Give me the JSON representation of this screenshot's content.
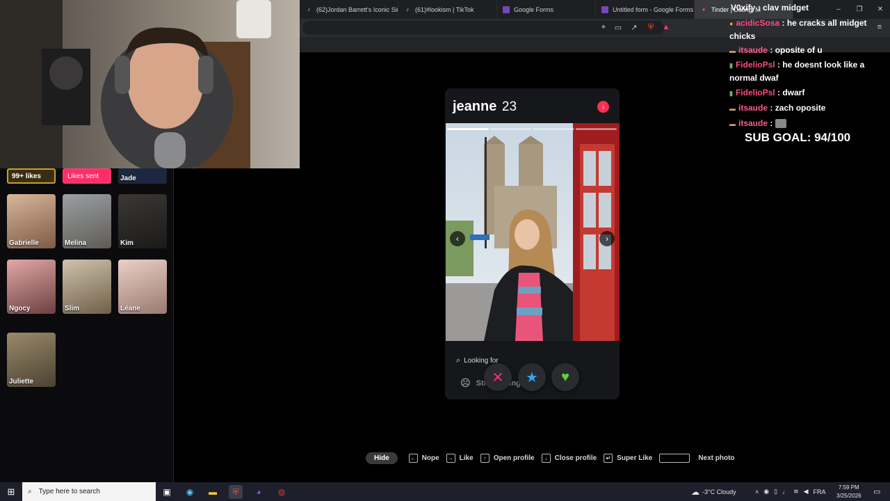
{
  "browser": {
    "tabs": [
      {
        "label": "(62)Jordan Barrett's Iconic Sina",
        "icon": "tiktok-icon"
      },
      {
        "label": "(61)#lookism | TikTok",
        "icon": "tiktok-icon"
      },
      {
        "label": "Google Forms",
        "icon": "forms-icon"
      },
      {
        "label": "Untitled form - Google Forms",
        "icon": "forms-icon"
      },
      {
        "label": "Tinder | Dating, M",
        "icon": "tinder-icon"
      }
    ]
  },
  "left_panel": {
    "likes_label": "99+ likes",
    "sent_label": "Likes sent",
    "profiles": [
      {
        "name": "Jade"
      },
      {
        "name": "Gabrielle"
      },
      {
        "name": "Melina"
      },
      {
        "name": "Kim"
      },
      {
        "name": "Ngocy"
      },
      {
        "name": "Slim"
      },
      {
        "name": "Léane"
      },
      {
        "name": "Juliette"
      }
    ]
  },
  "card": {
    "name": "jeanne",
    "age": "23",
    "looking_for_label": "Looking for",
    "looking_for_value": "Still figuring it out",
    "photo_count": 4,
    "active_photo": 1
  },
  "hints": {
    "hide": "Hide",
    "items": [
      {
        "key": "←",
        "label": "Nope"
      },
      {
        "key": "→",
        "label": "Like"
      },
      {
        "key": "↑",
        "label": "Open profile"
      },
      {
        "key": "↓",
        "label": "Close profile"
      },
      {
        "key": "↵",
        "label": "Super Like"
      },
      {
        "key": "",
        "label": "Next photo"
      }
    ]
  },
  "chat": {
    "messages": [
      {
        "user": "V0xify",
        "text": "clav midget"
      },
      {
        "user": "acidicSosa",
        "text": "he cracks all midget chicks"
      },
      {
        "user": "itsaude",
        "text": "oposite of u"
      },
      {
        "user": "FidelioPsl",
        "text": "he doesnt look like a normal dwaf"
      },
      {
        "user": "FidelioPsl",
        "text": "dwarf"
      },
      {
        "user": "itsaude",
        "text": "zach oposite"
      },
      {
        "user": "itsaude",
        "text": ""
      }
    ],
    "sub_goal": "SUB GOAL: 94/100"
  },
  "taskbar": {
    "search_placeholder": "Type here to search",
    "weather": "-3°C  Cloudy",
    "language": "FRA",
    "time": "7:59 PM",
    "date": "3/25/2026"
  }
}
